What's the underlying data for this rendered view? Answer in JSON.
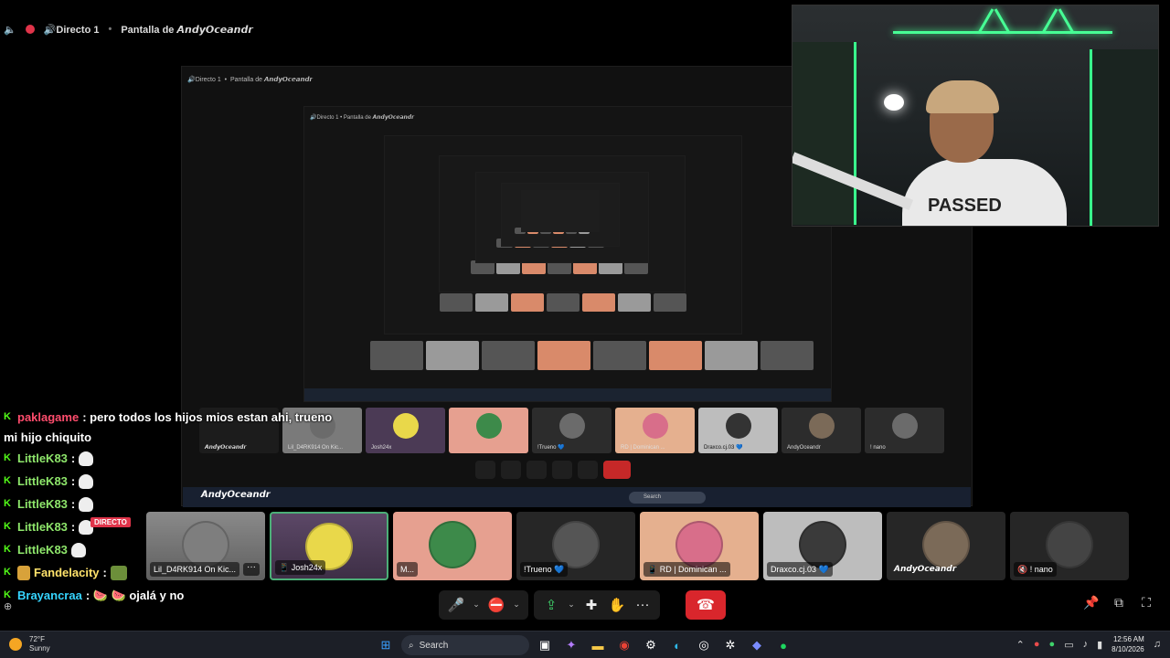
{
  "call_header": {
    "channel": "🔊Directo 1",
    "screen_share": "Pantalla de 𝘼𝙣𝙙𝙮𝙊𝙘𝙚𝙖𝙣𝙙𝙧"
  },
  "nested_share": {
    "channel": "🔊Directo 1",
    "screen_share": "Pantalla de 𝘼𝙣𝙙𝙮𝙊𝙘𝙚𝙖𝙣𝙙𝙧",
    "brand": "𝘼𝙣𝙙𝙮𝙊𝙘𝙚𝙖𝙣𝙙𝙧",
    "search": "Search",
    "tiles": [
      "Lil_D4RK914 On Kic...",
      "Josh24x",
      "",
      "!Trueno 💙",
      "RD | Dominican ...",
      "Draxco.cj.03 💙",
      "AndyOceandr",
      "! nano"
    ]
  },
  "webcam": {
    "shirt_text": "PASSED"
  },
  "chat": {
    "messages": [
      {
        "user": "paklagame",
        "text": ": pero todos los hijos mios estan ahi, trueno",
        "color": "#ff4d6d"
      },
      {
        "user": "",
        "text": "mi hijo chiquito",
        "color": "#ffffff"
      },
      {
        "user": "LittleK83",
        "text": ":",
        "color": "#8ee66b"
      },
      {
        "user": "LittleK83",
        "text": ":",
        "color": "#8ee66b"
      },
      {
        "user": "LittleK83",
        "text": ":",
        "color": "#8ee66b"
      },
      {
        "user": "LittleK83",
        "text": ":",
        "color": "#8ee66b"
      },
      {
        "user": "LittleK83",
        "text": "",
        "color": "#8ee66b"
      },
      {
        "user": "Fandelacity",
        "text": ":",
        "color": "#ffe26b"
      },
      {
        "user": "Brayancraa",
        "text": ": 🍉 🍉 ojalá y no",
        "color": "#36d5ff"
      }
    ],
    "badge": "DIRECTO"
  },
  "participants": [
    {
      "name": "Lil_D4RK914 On Kic...",
      "style": "bg-gray",
      "avatar": "a1",
      "selected": false,
      "more": "···"
    },
    {
      "name": "📱 Josh24x",
      "style": "bg-purple",
      "avatar": "a2",
      "selected": true,
      "more": ""
    },
    {
      "name": "M...",
      "style": "bg-salmon",
      "avatar": "a3",
      "selected": false,
      "more": ""
    },
    {
      "name": "!Trueno 💙",
      "style": "bg-dark",
      "avatar": "a4",
      "selected": false,
      "more": ""
    },
    {
      "name": "📱 RD | Dominican ...",
      "style": "bg-tan",
      "avatar": "a5",
      "selected": false,
      "more": ""
    },
    {
      "name": "Draxco.cj.03 💙",
      "style": "bg-light",
      "avatar": "a6",
      "selected": false,
      "more": ""
    },
    {
      "name": "𝘼𝙣𝙙𝙮𝙊𝙘𝙚𝙖𝙣𝙙𝙧",
      "style": "bg-dark",
      "avatar": "a7",
      "selected": false,
      "more": ""
    },
    {
      "name": "🔇 ! nano",
      "style": "bg-dark",
      "avatar": "a8",
      "selected": false,
      "more": ""
    }
  ],
  "controls": {
    "mic": "🎤",
    "mic_caret": "⌄",
    "camera": "⛔",
    "camera_caret": "⌄",
    "share": "⇪",
    "share_caret": "⌄",
    "activities": "✚",
    "soundboard": "✋",
    "more": "···",
    "hangup": "☎"
  },
  "right_tools": {
    "pin": "📌",
    "popout": "⧉",
    "fullscreen": "⛶"
  },
  "taskbar": {
    "weather_temp": "72°F",
    "weather_desc": "Sunny",
    "search_placeholder": "Search",
    "time": "12:56 AM",
    "date": "8/10/2026"
  }
}
